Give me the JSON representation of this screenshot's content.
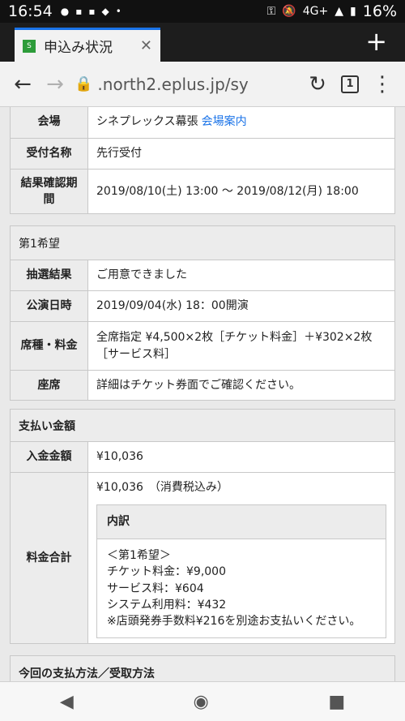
{
  "status": {
    "time": "16:54",
    "network": "4G+",
    "battery": "16%"
  },
  "browser": {
    "tab_title": "申込み状況",
    "url": ".north2.eplus.jp/sy",
    "tab_count": "1"
  },
  "venue_panel": {
    "rows": [
      {
        "label": "会場",
        "value": "シネプレックス幕張",
        "link": "会場案内"
      },
      {
        "label": "受付名称",
        "value": "先行受付"
      },
      {
        "label": "結果確認期間",
        "value": "2019/08/10(土) 13:00 〜 2019/08/12(月) 18:00"
      }
    ]
  },
  "choice_panel": {
    "header": "第1希望",
    "rows": [
      {
        "label": "抽選結果",
        "value": "ご用意できました"
      },
      {
        "label": "公演日時",
        "value": "2019/09/04(水) 18：00開演"
      },
      {
        "label": "席種・料金",
        "value": "全席指定 ¥4,500×2枚［チケット料金］＋¥302×2枚［サービス料］"
      },
      {
        "label": "座席",
        "value": "詳細はチケット券面でご確認ください。"
      }
    ]
  },
  "payment_panel": {
    "header": "支払い金額",
    "deposit_label": "入金金額",
    "deposit_value": "¥10,036",
    "total_label": "料金合計",
    "total_value": "¥10,036　（消費税込み）",
    "breakdown": {
      "title": "内訳",
      "lines": [
        "＜第1希望＞",
        "チケット料金：¥9,000",
        "サービス料：¥604",
        "システム利用料：¥432",
        "※店頭発券手数料¥216を別途お支払いください。"
      ]
    }
  },
  "method_panel": {
    "header": "今回の支払方法／受取方法"
  }
}
